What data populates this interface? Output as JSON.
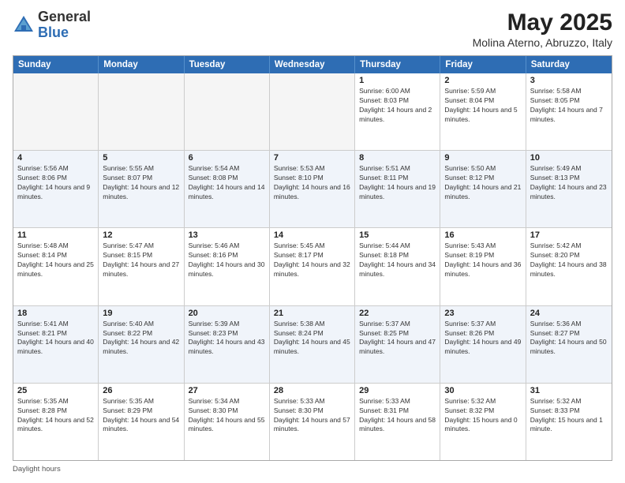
{
  "header": {
    "logo_general": "General",
    "logo_blue": "Blue",
    "month_title": "May 2025",
    "location": "Molina Aterno, Abruzzo, Italy"
  },
  "days_of_week": [
    "Sunday",
    "Monday",
    "Tuesday",
    "Wednesday",
    "Thursday",
    "Friday",
    "Saturday"
  ],
  "footer": {
    "note": "Daylight hours"
  },
  "rows": [
    [
      {
        "day": "",
        "empty": true
      },
      {
        "day": "",
        "empty": true
      },
      {
        "day": "",
        "empty": true
      },
      {
        "day": "",
        "empty": true
      },
      {
        "day": "1",
        "sunrise": "6:00 AM",
        "sunset": "8:03 PM",
        "daylight": "14 hours and 2 minutes."
      },
      {
        "day": "2",
        "sunrise": "5:59 AM",
        "sunset": "8:04 PM",
        "daylight": "14 hours and 5 minutes."
      },
      {
        "day": "3",
        "sunrise": "5:58 AM",
        "sunset": "8:05 PM",
        "daylight": "14 hours and 7 minutes."
      }
    ],
    [
      {
        "day": "4",
        "sunrise": "5:56 AM",
        "sunset": "8:06 PM",
        "daylight": "14 hours and 9 minutes."
      },
      {
        "day": "5",
        "sunrise": "5:55 AM",
        "sunset": "8:07 PM",
        "daylight": "14 hours and 12 minutes."
      },
      {
        "day": "6",
        "sunrise": "5:54 AM",
        "sunset": "8:08 PM",
        "daylight": "14 hours and 14 minutes."
      },
      {
        "day": "7",
        "sunrise": "5:53 AM",
        "sunset": "8:10 PM",
        "daylight": "14 hours and 16 minutes."
      },
      {
        "day": "8",
        "sunrise": "5:51 AM",
        "sunset": "8:11 PM",
        "daylight": "14 hours and 19 minutes."
      },
      {
        "day": "9",
        "sunrise": "5:50 AM",
        "sunset": "8:12 PM",
        "daylight": "14 hours and 21 minutes."
      },
      {
        "day": "10",
        "sunrise": "5:49 AM",
        "sunset": "8:13 PM",
        "daylight": "14 hours and 23 minutes."
      }
    ],
    [
      {
        "day": "11",
        "sunrise": "5:48 AM",
        "sunset": "8:14 PM",
        "daylight": "14 hours and 25 minutes."
      },
      {
        "day": "12",
        "sunrise": "5:47 AM",
        "sunset": "8:15 PM",
        "daylight": "14 hours and 27 minutes."
      },
      {
        "day": "13",
        "sunrise": "5:46 AM",
        "sunset": "8:16 PM",
        "daylight": "14 hours and 30 minutes."
      },
      {
        "day": "14",
        "sunrise": "5:45 AM",
        "sunset": "8:17 PM",
        "daylight": "14 hours and 32 minutes."
      },
      {
        "day": "15",
        "sunrise": "5:44 AM",
        "sunset": "8:18 PM",
        "daylight": "14 hours and 34 minutes."
      },
      {
        "day": "16",
        "sunrise": "5:43 AM",
        "sunset": "8:19 PM",
        "daylight": "14 hours and 36 minutes."
      },
      {
        "day": "17",
        "sunrise": "5:42 AM",
        "sunset": "8:20 PM",
        "daylight": "14 hours and 38 minutes."
      }
    ],
    [
      {
        "day": "18",
        "sunrise": "5:41 AM",
        "sunset": "8:21 PM",
        "daylight": "14 hours and 40 minutes."
      },
      {
        "day": "19",
        "sunrise": "5:40 AM",
        "sunset": "8:22 PM",
        "daylight": "14 hours and 42 minutes."
      },
      {
        "day": "20",
        "sunrise": "5:39 AM",
        "sunset": "8:23 PM",
        "daylight": "14 hours and 43 minutes."
      },
      {
        "day": "21",
        "sunrise": "5:38 AM",
        "sunset": "8:24 PM",
        "daylight": "14 hours and 45 minutes."
      },
      {
        "day": "22",
        "sunrise": "5:37 AM",
        "sunset": "8:25 PM",
        "daylight": "14 hours and 47 minutes."
      },
      {
        "day": "23",
        "sunrise": "5:37 AM",
        "sunset": "8:26 PM",
        "daylight": "14 hours and 49 minutes."
      },
      {
        "day": "24",
        "sunrise": "5:36 AM",
        "sunset": "8:27 PM",
        "daylight": "14 hours and 50 minutes."
      }
    ],
    [
      {
        "day": "25",
        "sunrise": "5:35 AM",
        "sunset": "8:28 PM",
        "daylight": "14 hours and 52 minutes."
      },
      {
        "day": "26",
        "sunrise": "5:35 AM",
        "sunset": "8:29 PM",
        "daylight": "14 hours and 54 minutes."
      },
      {
        "day": "27",
        "sunrise": "5:34 AM",
        "sunset": "8:30 PM",
        "daylight": "14 hours and 55 minutes."
      },
      {
        "day": "28",
        "sunrise": "5:33 AM",
        "sunset": "8:30 PM",
        "daylight": "14 hours and 57 minutes."
      },
      {
        "day": "29",
        "sunrise": "5:33 AM",
        "sunset": "8:31 PM",
        "daylight": "14 hours and 58 minutes."
      },
      {
        "day": "30",
        "sunrise": "5:32 AM",
        "sunset": "8:32 PM",
        "daylight": "15 hours and 0 minutes."
      },
      {
        "day": "31",
        "sunrise": "5:32 AM",
        "sunset": "8:33 PM",
        "daylight": "15 hours and 1 minute."
      }
    ]
  ]
}
